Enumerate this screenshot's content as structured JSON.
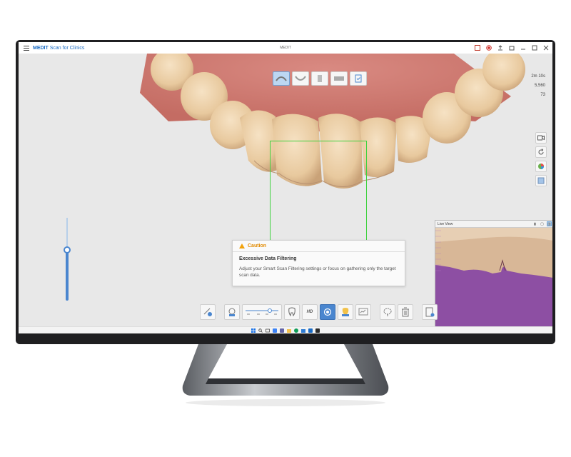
{
  "app": {
    "brand": "MEDIT",
    "title": "Scan for Clinics",
    "window_title": "MEDIT"
  },
  "titlebar_icons": [
    "report-icon",
    "record-icon",
    "upload-icon",
    "restore-icon",
    "minimize-icon",
    "maximize-icon",
    "close-icon"
  ],
  "stages": [
    {
      "name": "stage-upper-jaw",
      "active": true
    },
    {
      "name": "stage-lower-jaw",
      "active": false
    },
    {
      "name": "stage-occlusion",
      "active": false
    },
    {
      "name": "stage-data",
      "active": false
    },
    {
      "name": "stage-complete",
      "active": false
    }
  ],
  "stats": {
    "time": "2m 10s",
    "count": "5,560",
    "quality": "73"
  },
  "caution": {
    "label": "Caution",
    "heading": "Excessive Data Filtering",
    "message": "Adjust your Smart Scan Filtering settings or focus on gathering only the target scan data."
  },
  "live_view": {
    "label": "Live View"
  },
  "slider": {
    "level": 0.6
  },
  "toolbar": {
    "hd_label": "HD"
  },
  "colors": {
    "accent": "#4a86cf",
    "caution": "#e18a00",
    "focus_box": "#3fd23f",
    "brand": "#1a6bc4"
  }
}
